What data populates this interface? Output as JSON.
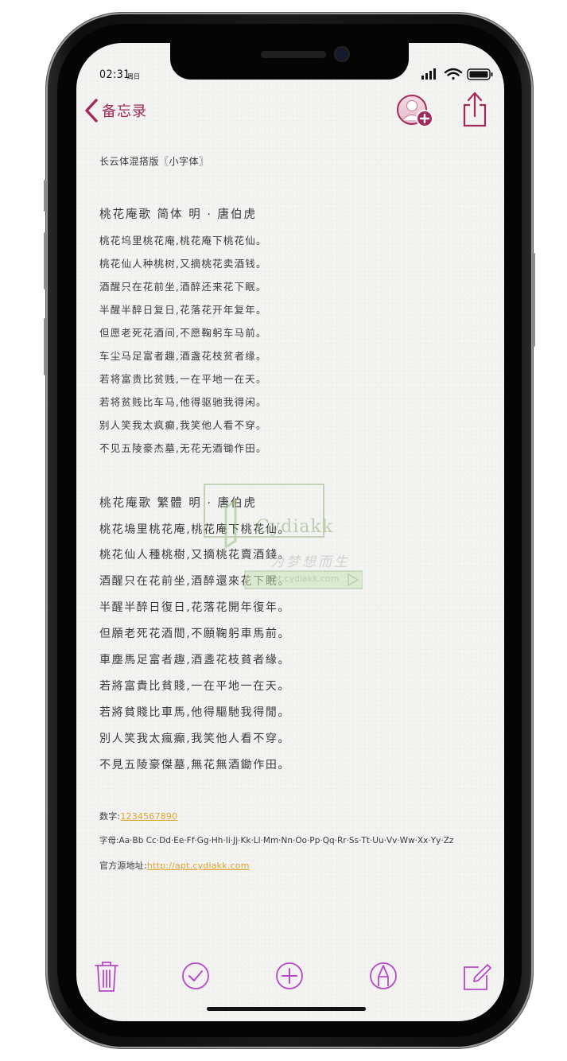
{
  "status_bar": {
    "time": "02:31",
    "day": "周日"
  },
  "nav": {
    "back_label": "备忘录"
  },
  "note": {
    "header": "长云体混搭版〖小字体〗",
    "poem_simplified": {
      "title": "桃花庵歌  简体 明 · 唐伯虎",
      "lines": [
        "桃花坞里桃花庵,桃花庵下桃花仙。",
        "桃花仙人种桃树,又摘桃花卖酒钱。",
        "酒醒只在花前坐,酒醉还来花下眠。",
        "半醒半醉日复日,花落花开年复年。",
        "但愿老死花酒间,不愿鞠躬车马前。",
        "车尘马足富者趣,酒盏花枝贫者缘。",
        "若将富贵比贫贱,一在平地一在天。",
        "若将贫贱比车马,他得驱驰我得闲。",
        "别人笑我太疯癫,我笑他人看不穿。",
        "不见五陵豪杰墓,无花无酒锄作田。"
      ]
    },
    "poem_traditional": {
      "title": "桃花庵歌  繁體 明 · 唐伯虎",
      "lines": [
        "桃花塢里桃花庵,桃花庵下桃花仙。",
        "桃花仙人種桃樹,又摘桃花賣酒錢。",
        "酒醒只在花前坐,酒醉還來花下眠。",
        "半醒半醉日復日,花落花開年復年。",
        "但願老死花酒間,不願鞠躬車馬前。",
        "車塵馬足富者趣,酒盞花枝貧者緣。",
        "若將富貴比貧賤,一在平地一在天。",
        "若將貧賤比車馬,他得驅馳我得閒。",
        "別人笑我太瘋癲,我笑他人看不穿。",
        "不見五陵豪傑墓,無花無酒鋤作田。"
      ]
    },
    "numbers_label": "数字:",
    "numbers_value": "1234567890",
    "letters_label": "字母:",
    "letters_value": "Aa·Bb Cc·Dd·Ee·Ff·Gg·Hh·Ii·Jj·Kk·Ll·Mm·Nn·Oo·Pp·Qq·Rr·Ss·Tt·Uu·Vv·Ww·Xx·Yy·Zz",
    "source_label": "官方源地址:",
    "source_url": "http://apt.cydiakk.com"
  },
  "watermark": {
    "brand": "Cydiakk",
    "slogan": "为梦想而生",
    "url": "apt.cydiakk.com"
  },
  "colors": {
    "accent": "#a3295c",
    "toolbar": "#b648c9",
    "link": "#e0a32b"
  },
  "toolbar": {
    "icons": [
      "trash-icon",
      "checkmark-circle-icon",
      "plus-circle-icon",
      "markup-pen-icon",
      "compose-icon"
    ]
  }
}
